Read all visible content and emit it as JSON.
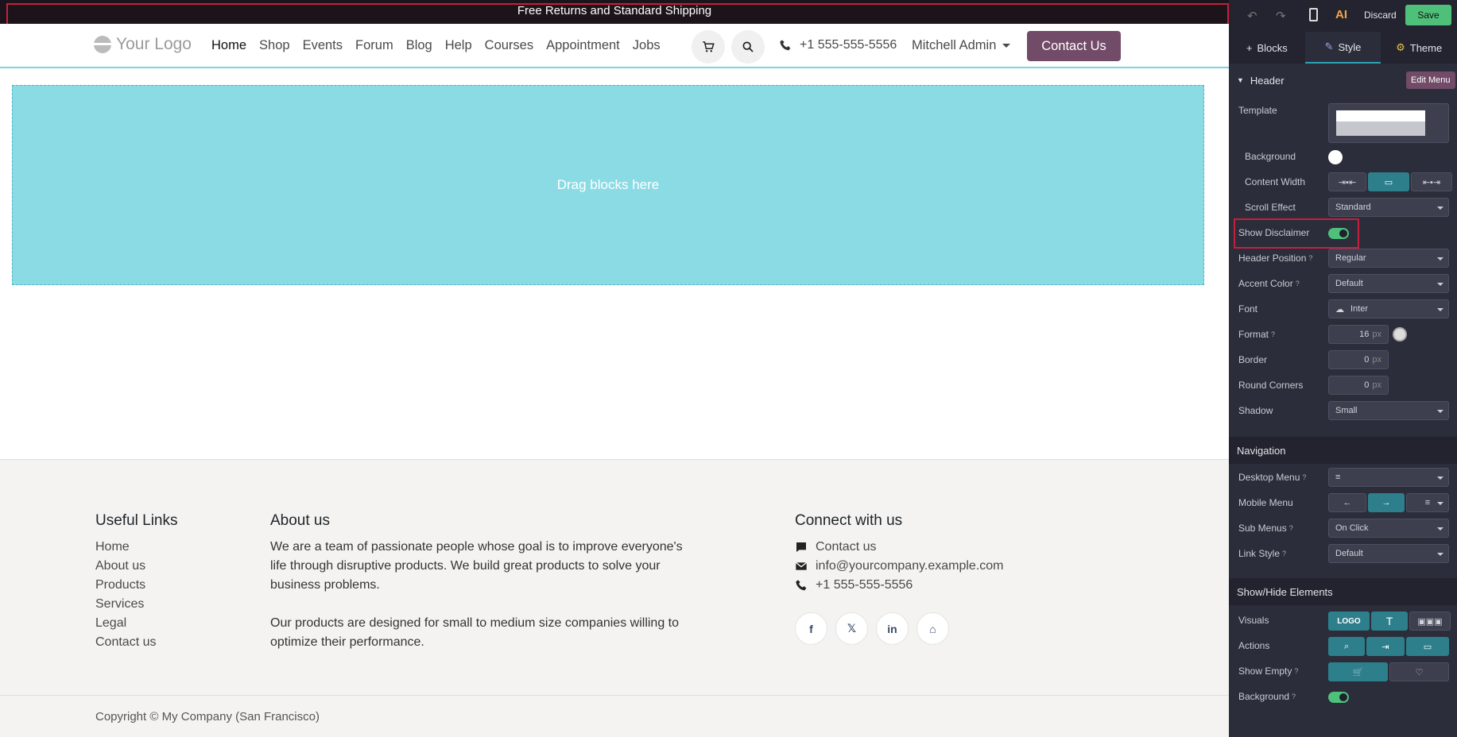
{
  "disclaimer": "Free Returns and Standard Shipping",
  "header": {
    "logo": "Your Logo",
    "nav": [
      "Home",
      "Shop",
      "Events",
      "Forum",
      "Blog",
      "Help",
      "Courses",
      "Appointment",
      "Jobs"
    ],
    "phone": "+1 555-555-5556",
    "user": "Mitchell Admin",
    "cta": "Contact Us"
  },
  "dropzone": "Drag blocks here",
  "footer": {
    "useful_title": "Useful Links",
    "useful_links": [
      "Home",
      "About us",
      "Products",
      "Services",
      "Legal",
      "Contact us"
    ],
    "about_title": "About us",
    "about_p1": "We are a team of passionate people whose goal is to improve everyone's life through disruptive products. We build great products to solve your business problems.",
    "about_p2": "Our products are designed for small to medium size companies willing to optimize their performance.",
    "connect_title": "Connect with us",
    "connect": {
      "contact": "Contact us",
      "email": "info@yourcompany.example.com",
      "phone": "+1 555-555-5556"
    },
    "copyright": "Copyright © My Company (San Francisco)"
  },
  "panel": {
    "discard": "Discard",
    "save": "Save",
    "ai": "AI",
    "tabs": {
      "blocks": "Blocks",
      "style": "Style",
      "theme": "Theme"
    },
    "header_section": "Header",
    "edit_menu": "Edit Menu",
    "labels": {
      "template": "Template",
      "background": "Background",
      "content_width": "Content Width",
      "scroll_effect": "Scroll Effect",
      "show_disclaimer": "Show Disclaimer",
      "header_position": "Header Position",
      "accent_color": "Accent Color",
      "font": "Font",
      "format": "Format",
      "border": "Border",
      "round_corners": "Round Corners",
      "shadow": "Shadow",
      "desktop_menu": "Desktop Menu",
      "mobile_menu": "Mobile Menu",
      "sub_menus": "Sub Menus",
      "link_style": "Link Style",
      "visuals": "Visuals",
      "actions": "Actions",
      "show_empty": "Show Empty",
      "background2": "Background"
    },
    "values": {
      "scroll_effect": "Standard",
      "header_position": "Regular",
      "accent_color": "Default",
      "font": "Inter",
      "format": "16",
      "border": "0",
      "round_corners": "0",
      "unit": "px",
      "shadow": "Small",
      "sub_menus": "On Click",
      "link_style": "Default",
      "visual_logo": "LOGO"
    },
    "navigation_section": "Navigation",
    "showhide_section": "Show/Hide Elements"
  }
}
